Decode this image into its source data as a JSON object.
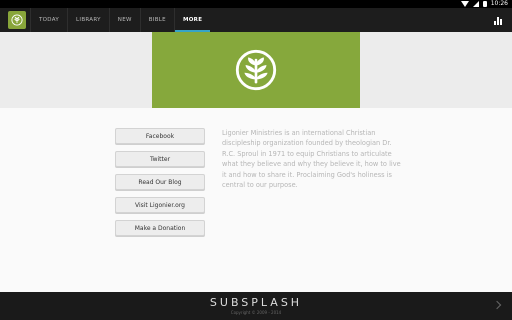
{
  "status_bar": {
    "time": "10:26"
  },
  "nav": {
    "tabs": [
      {
        "label": "TODAY"
      },
      {
        "label": "LIBRARY"
      },
      {
        "label": "NEW"
      },
      {
        "label": "BIBLE"
      },
      {
        "label": "MORE",
        "active": true
      }
    ]
  },
  "links": [
    {
      "label": "Facebook"
    },
    {
      "label": "Twitter"
    },
    {
      "label": "Read Our Blog"
    },
    {
      "label": "Visit Ligonier.org"
    },
    {
      "label": "Make a Donation"
    }
  ],
  "about_text": "Ligonier Ministries is an international Christian discipleship organization founded by theologian Dr. R.C. Sproul in 1971 to equip Christians to articulate what they believe and why they believe it, how to live it and how to share it. Proclaiming God's holiness is central to our purpose.",
  "footer": {
    "brand": "SUBSPLASH",
    "copyright": "Copyright © 2009 - 2014"
  },
  "colors": {
    "brand_green": "#86a83c",
    "active_tab_underline": "#35a4c8",
    "app_bar": "#1d1d1d"
  },
  "icons": {
    "app_logo": "ligonier-logo-icon",
    "stats": "bar-chart-icon",
    "footer_next": "chevron-right-icon"
  }
}
